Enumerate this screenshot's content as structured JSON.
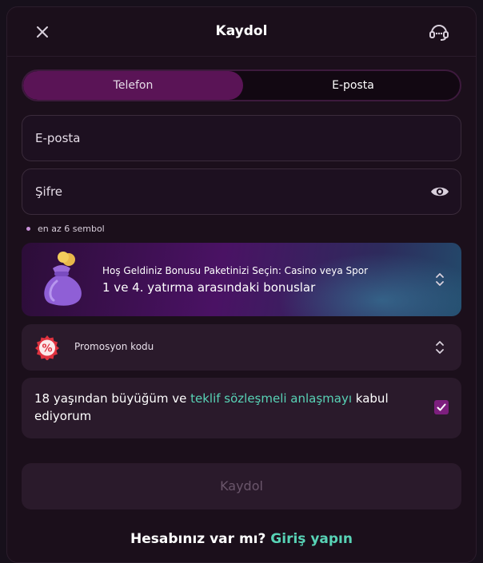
{
  "header": {
    "title": "Kaydol"
  },
  "tabs": [
    {
      "label": "Telefon",
      "active": true
    },
    {
      "label": "E-posta",
      "active": false
    }
  ],
  "form": {
    "email_placeholder": "E-posta",
    "password_placeholder": "Şifre",
    "password_hint": "en az 6 sembol"
  },
  "bonus": {
    "subtitle": "Hoş Geldiniz Bonusu Paketinizi Seçin: Casino veya Spor",
    "title": "1 ve 4. yatırma arasındaki bonuslar"
  },
  "promo": {
    "label": "Promosyon kodu",
    "badge": "%"
  },
  "agreement": {
    "text_before": "18 yaşından büyüğüm ve ",
    "link_text": "teklif sözleşmeli anlaşmayı",
    "text_after": " kabul ediyorum",
    "checked": true
  },
  "submit_label": "Kaydol",
  "footer": {
    "question": "Hesabınız var mı?",
    "login_link": "Giriş yapın"
  },
  "colors": {
    "accent": "#58d3b6",
    "tab_active": "#5a1456",
    "checkbox": "#7d1f7e"
  }
}
